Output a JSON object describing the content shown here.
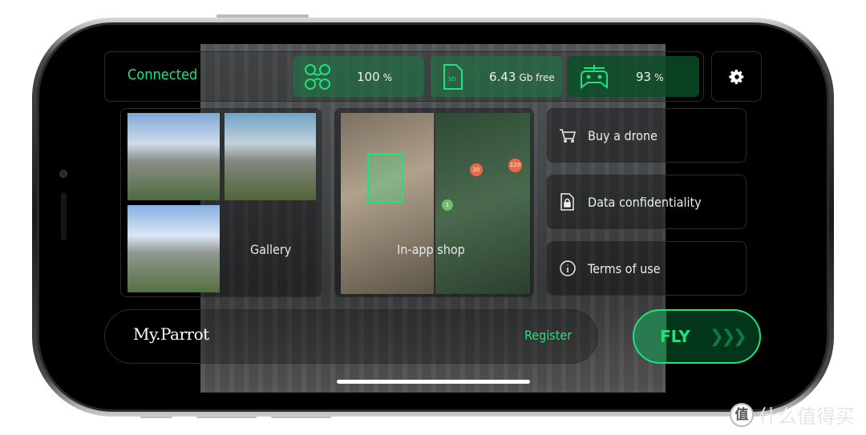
{
  "status": {
    "connection": "Connected"
  },
  "stats": [
    {
      "icon": "drone-icon",
      "value": "100",
      "unit": "%"
    },
    {
      "icon": "sd-card-icon",
      "icon_text": "SD",
      "value": "6.43",
      "unit": "Gb free"
    },
    {
      "icon": "controller-icon",
      "value": "93",
      "unit": "%"
    }
  ],
  "tiles": {
    "gallery": "Gallery",
    "shop": "In-app shop",
    "map_markers": [
      "20",
      "120",
      "1"
    ]
  },
  "menu": [
    {
      "icon": "cart-icon",
      "label": "Buy a drone"
    },
    {
      "icon": "lock-document-icon",
      "label": "Data confidentiality"
    },
    {
      "icon": "info-icon",
      "label": "Terms of use"
    }
  ],
  "account": {
    "logo": "My.Parrot",
    "register": "Register"
  },
  "fly": {
    "label": "FLY"
  },
  "colors": {
    "accent": "#1fe37a",
    "stat_bg": "#1e7846"
  },
  "watermark": {
    "badge": "值",
    "text": "什么值得买"
  }
}
